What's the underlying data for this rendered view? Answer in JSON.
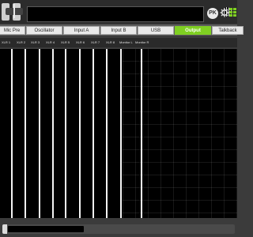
{
  "header": {
    "pk_label": "PK",
    "icons": [
      "pk-icon",
      "hall-icon",
      "gear-icon",
      "grid-icon"
    ]
  },
  "tabs": [
    {
      "label": "Mic Pre",
      "active": false
    },
    {
      "label": "Oscillator",
      "active": false
    },
    {
      "label": "Input A",
      "active": false
    },
    {
      "label": "Input B",
      "active": false
    },
    {
      "label": "USB",
      "active": false
    },
    {
      "label": "Output",
      "active": true
    },
    {
      "label": "Talkback",
      "active": false
    }
  ],
  "channels": [
    "XLR 1",
    "XLR 2",
    "XLR 3",
    "XLR 4",
    "XLR 5",
    "XLR 6",
    "XLR 7",
    "XLR 8",
    "Monitor L",
    "Monitor R"
  ],
  "colors": {
    "accent": "#7fcf22",
    "plot_bg": "#000000",
    "meter": "#f4f4f4"
  }
}
